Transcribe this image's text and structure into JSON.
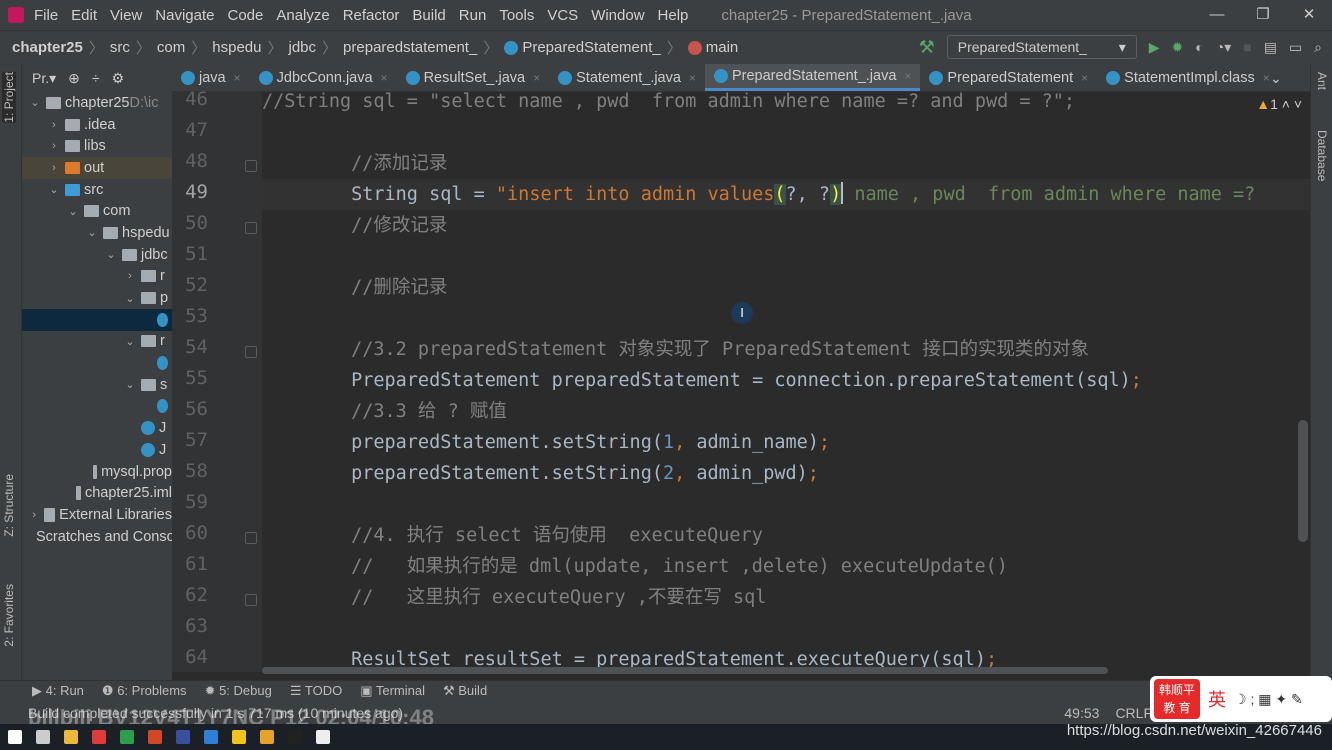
{
  "menu": {
    "items": [
      "File",
      "Edit",
      "View",
      "Navigate",
      "Code",
      "Analyze",
      "Refactor",
      "Build",
      "Run",
      "Tools",
      "VCS",
      "Window",
      "Help"
    ],
    "window_title": "chapter25 - PreparedStatement_.java",
    "controls": [
      "—",
      "❐",
      "✕"
    ]
  },
  "breadcrumb": [
    "chapter25",
    "src",
    "com",
    "hspedu",
    "jdbc",
    "preparedstatement_",
    "PreparedStatement_",
    "main"
  ],
  "run_config": {
    "name": "PreparedStatement_"
  },
  "left_stripe": {
    "project": "1: Project",
    "structure": "Z: Structure",
    "favorites": "2: Favorites"
  },
  "right_stripe": {
    "ant": "Ant",
    "database": "Database"
  },
  "project": {
    "header": "Pr.▾",
    "tree": [
      {
        "label": "chapter25",
        "extra": " D:\\ic",
        "level": 0,
        "arrow": "⌄",
        "icon": "module"
      },
      {
        "label": ".idea",
        "level": 1,
        "arrow": "›",
        "icon": "folder"
      },
      {
        "label": "libs",
        "level": 1,
        "arrow": "›",
        "icon": "folder"
      },
      {
        "label": "out",
        "level": 1,
        "arrow": "›",
        "icon": "folder-orange",
        "hl": true
      },
      {
        "label": "src",
        "level": 1,
        "arrow": "⌄",
        "icon": "folder-blue"
      },
      {
        "label": "com",
        "level": 2,
        "arrow": "⌄",
        "icon": "folder"
      },
      {
        "label": "hspedu",
        "level": 3,
        "arrow": "⌄",
        "icon": "folder"
      },
      {
        "label": "jdbc",
        "level": 4,
        "arrow": "⌄",
        "icon": "folder"
      },
      {
        "label": "r",
        "level": 5,
        "arrow": "›",
        "icon": "folder"
      },
      {
        "label": "p",
        "level": 5,
        "arrow": "⌄",
        "icon": "folder"
      },
      {
        "label": "",
        "level": 6,
        "arrow": "",
        "icon": "class",
        "sel": true
      },
      {
        "label": "r",
        "level": 5,
        "arrow": "⌄",
        "icon": "folder"
      },
      {
        "label": "",
        "level": 6,
        "arrow": "",
        "icon": "class"
      },
      {
        "label": "s",
        "level": 5,
        "arrow": "⌄",
        "icon": "folder"
      },
      {
        "label": "",
        "level": 6,
        "arrow": "",
        "icon": "class"
      },
      {
        "label": "J",
        "level": 5,
        "arrow": "",
        "icon": "class"
      },
      {
        "label": "J",
        "level": 5,
        "arrow": "",
        "icon": "class"
      },
      {
        "label": "mysql.prop",
        "level": 3,
        "arrow": "",
        "icon": "file"
      },
      {
        "label": "chapter25.iml",
        "level": 2,
        "arrow": "",
        "icon": "file"
      },
      {
        "label": "External Libraries",
        "level": 0,
        "arrow": "›",
        "icon": "library"
      },
      {
        "label": "Scratches and Consoles",
        "level": 0,
        "arrow": "",
        "icon": "scratch"
      }
    ]
  },
  "tabs": [
    {
      "label": "java",
      "active": false
    },
    {
      "label": "JdbcConn.java",
      "active": false
    },
    {
      "label": "ResultSet_.java",
      "active": false
    },
    {
      "label": "Statement_.java",
      "active": false
    },
    {
      "label": "PreparedStatement_.java",
      "active": true
    },
    {
      "label": "PreparedStatement",
      "active": false
    },
    {
      "label": "StatementImpl.class",
      "active": false
    }
  ],
  "editor": {
    "warning_count": "1",
    "current_line": 49,
    "lines": [
      {
        "n": 46,
        "t": [
          [
            "//String sql = \"select name , pwd  from admin where name =? and pwd = ?\";",
            "cm"
          ]
        ]
      },
      {
        "n": 47,
        "t": []
      },
      {
        "n": 48,
        "fold": true,
        "t": [
          [
            "        //添加记录",
            "cm"
          ]
        ]
      },
      {
        "n": 49,
        "t": [
          [
            "        String sql = ",
            ""
          ],
          [
            "\"insert into admin values",
            "sq"
          ],
          [
            "(",
            "br"
          ],
          [
            "?, ?",
            ""
          ],
          [
            ")",
            "br"
          ],
          [
            "|caret",
            ""
          ],
          [
            " name , pwd  from admin where name =?",
            "st"
          ]
        ]
      },
      {
        "n": 50,
        "fold": true,
        "t": [
          [
            "        //修改记录",
            "cm"
          ]
        ]
      },
      {
        "n": 51,
        "t": []
      },
      {
        "n": 52,
        "t": [
          [
            "        //删除记录",
            "cm"
          ]
        ]
      },
      {
        "n": 53,
        "t": []
      },
      {
        "n": 54,
        "fold": true,
        "t": [
          [
            "        //3.2 preparedStatement 对象实现了 PreparedStatement 接口的实现类的对象",
            "cm"
          ]
        ]
      },
      {
        "n": 55,
        "t": [
          [
            "        PreparedStatement preparedStatement = connection.prepareStatement(sql)",
            ""
          ],
          [
            ";",
            "kw"
          ]
        ]
      },
      {
        "n": 56,
        "t": [
          [
            "        //3.3 给 ? 赋值",
            "cm"
          ]
        ]
      },
      {
        "n": 57,
        "t": [
          [
            "        preparedStatement.setString(",
            ""
          ],
          [
            "1",
            "num"
          ],
          [
            ", ",
            "kw"
          ],
          [
            "admin_name)",
            ""
          ],
          [
            ";",
            "kw"
          ]
        ]
      },
      {
        "n": 58,
        "t": [
          [
            "        preparedStatement.setString(",
            ""
          ],
          [
            "2",
            "num"
          ],
          [
            ", ",
            "kw"
          ],
          [
            "admin_pwd)",
            ""
          ],
          [
            ";",
            "kw"
          ]
        ]
      },
      {
        "n": 59,
        "t": []
      },
      {
        "n": 60,
        "fold": true,
        "t": [
          [
            "        //4. 执行 select 语句使用  executeQuery",
            "cm"
          ]
        ]
      },
      {
        "n": 61,
        "t": [
          [
            "        //   如果执行的是 dml(update, insert ,delete) executeUpdate()",
            "cm"
          ]
        ]
      },
      {
        "n": 62,
        "fold": true,
        "t": [
          [
            "        //   这里执行 executeQuery ,不要在写 sql",
            "cm"
          ]
        ]
      },
      {
        "n": 63,
        "t": []
      },
      {
        "n": 64,
        "t": [
          [
            "        ResultSet resultSet = preparedStatement.executeQuery(sql)",
            ""
          ],
          [
            ";",
            "kw"
          ]
        ]
      }
    ]
  },
  "toolwindows": [
    "▶ 4: Run",
    "❶ 6: Problems",
    "✹ 5: Debug",
    "☰ TODO",
    "▣ Terminal",
    "⚒ Build"
  ],
  "status": {
    "message": "Build completed successfully in 1 s 717 ms (10 minutes ago)",
    "position": "49:53",
    "line_sep": "CRLF"
  },
  "overlay": {
    "watermark": "bilibili BV12V4T1Y7NC P12 02:04/10:48",
    "ime_badge": "韩顺平 教 育",
    "ime_lang": "英",
    "url": "https://blog.csdn.net/weixin_42667446"
  },
  "colors": {
    "accent": "#4a88c7",
    "background": "#2b2b2b",
    "comment": "#808080",
    "keyword": "#cc7832",
    "string": "#6a8759",
    "number": "#6897bb"
  }
}
